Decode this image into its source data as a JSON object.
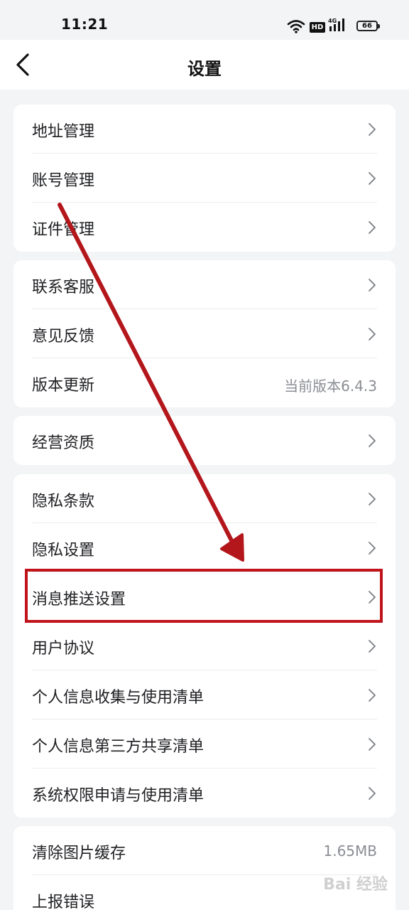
{
  "status_bar": {
    "time": "11:21",
    "hd": "HD",
    "network": "4G",
    "battery": "66"
  },
  "header": {
    "title": "设置",
    "back_icon": "chevron-left-icon"
  },
  "groups": [
    {
      "items": [
        {
          "label": "地址管理"
        },
        {
          "label": "账号管理"
        },
        {
          "label": "证件管理"
        }
      ]
    },
    {
      "items": [
        {
          "label": "联系客服"
        },
        {
          "label": "意见反馈"
        },
        {
          "label": "版本更新",
          "value": "当前版本6.4.3"
        }
      ]
    },
    {
      "items": [
        {
          "label": "经营资质"
        }
      ]
    },
    {
      "items": [
        {
          "label": "隐私条款"
        },
        {
          "label": "隐私设置"
        },
        {
          "label": "消息推送设置"
        },
        {
          "label": "用户协议"
        },
        {
          "label": "个人信息收集与使用清单"
        },
        {
          "label": "个人信息第三方共享清单"
        },
        {
          "label": "系统权限申请与使用清单"
        }
      ]
    },
    {
      "items": [
        {
          "label": "清除图片缓存",
          "value": "1.65MB"
        },
        {
          "label": "上报错误"
        }
      ]
    }
  ],
  "annotation": {
    "color": "#c0141a",
    "highlighted_item": "消息推送设置"
  },
  "watermark": "Bai 经验"
}
